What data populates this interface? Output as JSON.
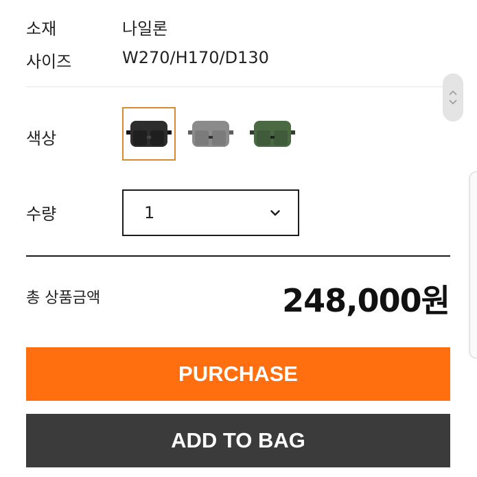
{
  "specs": [
    {
      "label": "소재",
      "value": "나일론"
    },
    {
      "label": "사이즈",
      "value": "W270/H170/D130"
    }
  ],
  "color": {
    "label": "색상",
    "options": [
      {
        "name": "black-bag",
        "body": "#2c2d2c",
        "pocket": "#1e1f1e",
        "strap": "#151515",
        "selected": true
      },
      {
        "name": "gray-bag",
        "body": "#8a8b8a",
        "pocket": "#7a7b7a",
        "strap": "#5e5f5e",
        "selected": false
      },
      {
        "name": "green-bag",
        "body": "#4b6a44",
        "pocket": "#3f5b3a",
        "strap": "#2e4129",
        "selected": false
      }
    ]
  },
  "quantity": {
    "label": "수량",
    "value": "1"
  },
  "total": {
    "label": "총 상품금액",
    "price": "248,000원"
  },
  "buttons": {
    "purchase": "PURCHASE",
    "add_to_bag": "ADD TO BAG"
  },
  "colors": {
    "accent": "#ff6f0f",
    "dark_button": "#3b3b3b",
    "selected_border": "#d98a2e"
  }
}
